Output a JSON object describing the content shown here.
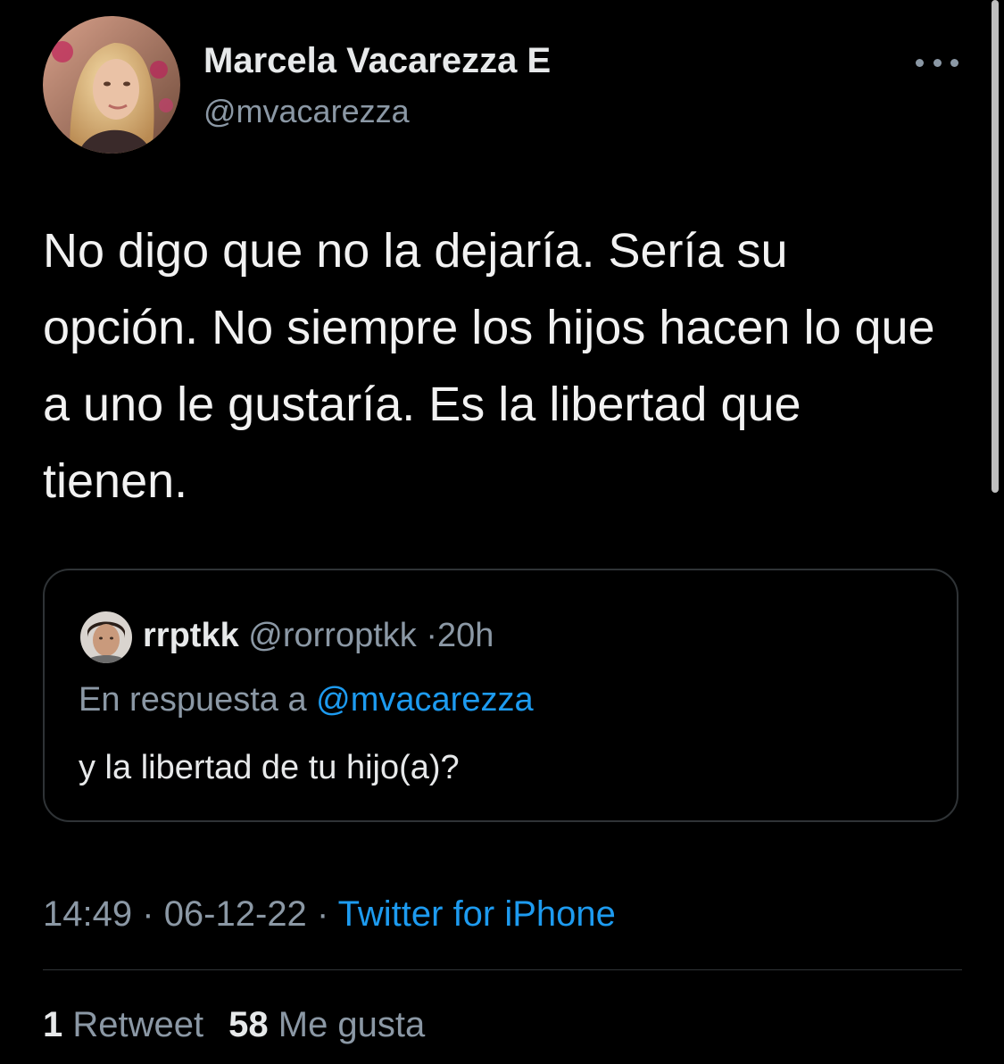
{
  "author": {
    "name": "Marcela Vacarezza E",
    "handle": "@mvacarezza"
  },
  "tweet": {
    "text": "No digo que no la dejaría. Sería su opción. No siempre los hijos hacen lo que a uno le gustaría. Es la libertad que tienen."
  },
  "quoted_tweet": {
    "name": "rrptkk",
    "handle": "@rorroptkk",
    "separator": "·",
    "time_ago": "20h",
    "reply_prefix": "En respuesta a",
    "reply_to": "@mvacarezza",
    "text": "y la libertad de tu hijo(a)?"
  },
  "meta": {
    "time": "14:49",
    "separator": "·",
    "date": "06-12-22",
    "source": "Twitter for iPhone"
  },
  "stats": {
    "retweets_count": "1",
    "retweets_label": "Retweet",
    "likes_count": "58",
    "likes_label": "Me gusta"
  },
  "icons": {
    "more": "more-horizontal-icon"
  },
  "colors": {
    "background": "#000000",
    "text": "#e7e9ea",
    "secondary": "#8b98a5",
    "accent": "#1d9bf0",
    "border": "#2f3336"
  }
}
